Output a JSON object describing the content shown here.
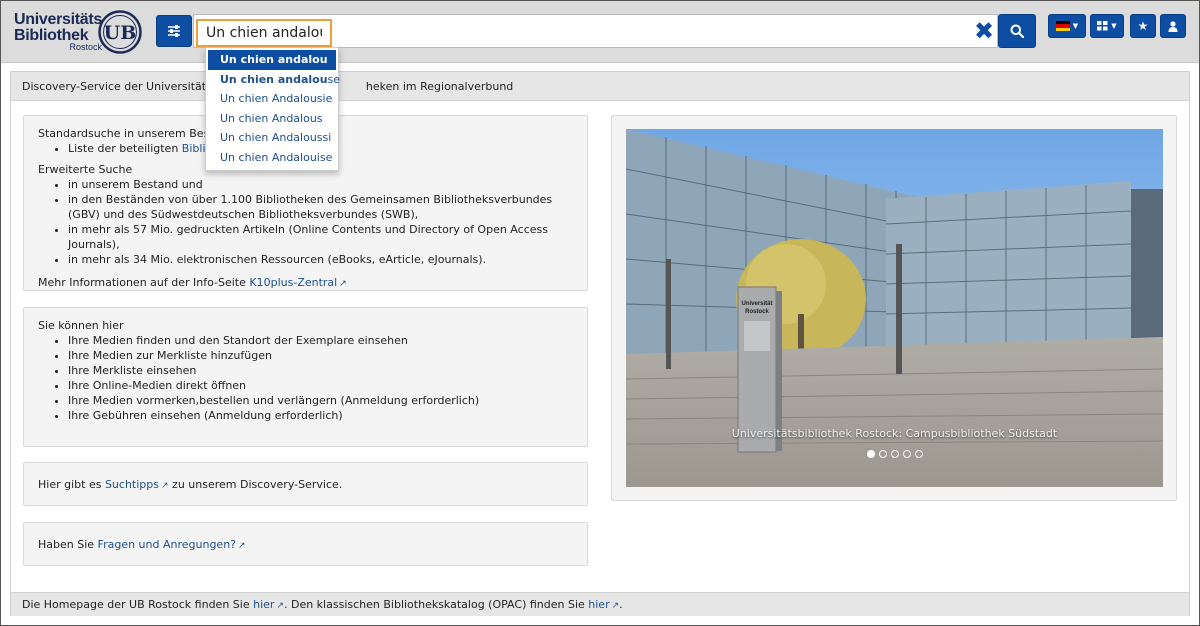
{
  "header": {
    "logo": {
      "line1": "Universitäts",
      "line2": "Bibliothek",
      "line3": "Rostock",
      "seal_text": "UB"
    },
    "search": {
      "value": "Un chien andalou"
    },
    "language_flag": "flag-de-icon",
    "colors": {
      "primary": "#0d4ea3",
      "highlight": "#f0a03a"
    }
  },
  "autocomplete": {
    "items": [
      {
        "bold": "Un chien andalou",
        "rest": ""
      },
      {
        "bold": "Un chien andalou",
        "rest": "se"
      },
      {
        "bold": "",
        "rest": "Un chien Andalousie"
      },
      {
        "bold": "",
        "rest": "Un chien Andalous"
      },
      {
        "bold": "",
        "rest": "Un chien Andaloussi"
      },
      {
        "bold": "",
        "rest": "Un chien Andalouise"
      }
    ]
  },
  "topbar": {
    "text_start": "Discovery-Service der Universitätsbibl",
    "text_end": "heken im Regionalverbund"
  },
  "panel1": {
    "standard_start": "Standardsuche in unserem Bestand",
    "standard_list_prefix": "Liste der beteiligten ",
    "standard_list_link": "Biblioth",
    "extended_title": "Erweiterte Suche",
    "extended_items": [
      "in unserem Bestand und",
      "in den Beständen von über 1.100 Bibliotheken des Gemeinsamen Bibliotheksverbundes (GBV) und des Südwestdeutschen Bibliotheksverbundes (SWB),",
      "in mehr als 57 Mio. gedruckten Artikeln (Online Contents und Directory of Open Access Journals),",
      "in mehr als 34 Mio. elektronischen Ressourcen (eBooks, eArticle, eJournals)."
    ],
    "info_prefix": "Mehr Informationen auf der Info-Seite ",
    "info_link": "K10plus-Zentral"
  },
  "panel2": {
    "title": "Sie können hier",
    "items": [
      "Ihre Medien finden und den Standort der Exemplare einsehen",
      "Ihre Medien zur Merkliste hinzufügen",
      "Ihre Merkliste einsehen",
      "Ihre Online-Medien direkt öffnen",
      "Ihre Medien vormerken,bestellen und verlängern (Anmeldung erforderlich)",
      "Ihre Gebühren einsehen (Anmeldung erforderlich)"
    ]
  },
  "panel3": {
    "prefix": "Hier gibt es ",
    "link": "Suchtipps",
    "suffix": " zu unserem Discovery-Service."
  },
  "panel4": {
    "prefix": "Haben Sie ",
    "link": "Fragen und Anregungen?"
  },
  "carousel": {
    "caption": "Universitätsbibliothek Rostock: Campusbibliothek Südstadt",
    "sign_line1": "Universität",
    "sign_line2": "Rostock",
    "slide_count": 5,
    "active_slide": 1
  },
  "footer": {
    "text1": "Die Homepage der UB Rostock finden Sie ",
    "link1": "hier",
    "text2": ". Den klassischen Bibliothekskatalog (OPAC) finden Sie ",
    "link2": "hier",
    "text3": "."
  }
}
